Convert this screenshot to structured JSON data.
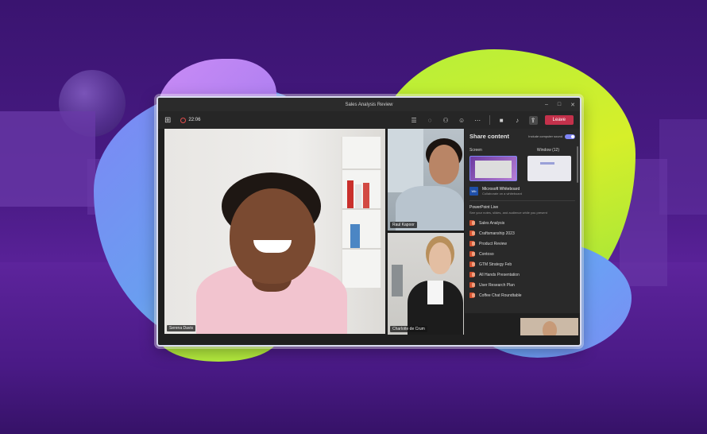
{
  "window": {
    "title": "Sales Analysis Review",
    "controls": [
      "–",
      "□",
      "✕"
    ]
  },
  "toolbar": {
    "recording_time": "22:06",
    "leave_label": "Leave",
    "icons": [
      "grid-icon",
      "record-icon",
      "list-icon",
      "chat-icon",
      "people-icon",
      "react-icon",
      "more-icon",
      "camera-icon",
      "mic-icon",
      "share-icon"
    ]
  },
  "participants": [
    {
      "name": "Serena Davis"
    },
    {
      "name": "Raul Kapoor"
    },
    {
      "name": "Charlotte de Crum"
    }
  ],
  "share_panel": {
    "title": "Share content",
    "include_sound_label": "Include computer sound",
    "include_sound_on": true,
    "screen_label": "Screen",
    "window_label": "Window (12)",
    "whiteboard": {
      "icon_text": "Wb",
      "title": "Microsoft Whiteboard",
      "subtitle": "Collaborate on a whiteboard"
    },
    "powerpoint": {
      "title": "PowerPoint Live",
      "subtitle": "See your notes, slides, and audience while you present",
      "files": [
        "Sales Analysis",
        "Craftsmanship 2023",
        "Product Review",
        "Contoso",
        "GTM Strategy Feb",
        "All Hands Presentation",
        "User Research Plan",
        "Coffee Chat Roundtable"
      ]
    }
  },
  "colors": {
    "accent": "#7f85f5",
    "leave": "#c4314b",
    "powerpoint": "#d35230",
    "panel_bg": "#292929"
  }
}
